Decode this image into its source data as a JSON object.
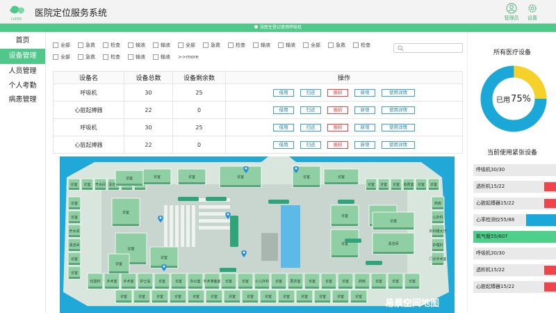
{
  "header": {
    "title": "医院定位服务系统",
    "logo_text": "LVPER",
    "actions": [
      {
        "label": "管理员",
        "icon": "user-icon"
      },
      {
        "label": "设置",
        "icon": "gear-icon"
      }
    ]
  },
  "notice": "张医生登记使用呼吸机",
  "sidebar": {
    "items": [
      {
        "label": "首页",
        "active": false
      },
      {
        "label": "设备管理",
        "active": true
      },
      {
        "label": "人员管理",
        "active": false
      },
      {
        "label": "个人考勤",
        "active": false
      },
      {
        "label": "病患管理",
        "active": false
      }
    ]
  },
  "filters": {
    "row1": [
      "全部",
      "急救",
      "检查",
      "输液",
      "输液",
      "全部",
      "急救",
      "检查",
      "输液",
      "输液",
      "全部",
      "急救",
      "检查"
    ],
    "row2": [
      "全部",
      "急救",
      "检查",
      "输液",
      "输液"
    ],
    "more": ">>more"
  },
  "table": {
    "headers": [
      "设备名",
      "设备总数",
      "设备剩余数",
      "操作"
    ],
    "op_labels": [
      "借用",
      "归还",
      "报损",
      "新增",
      "使用详情"
    ],
    "rows": [
      {
        "name": "呼吸机",
        "total": "30",
        "remain": "25",
        "remain_zero": false
      },
      {
        "name": "心脏起搏器",
        "total": "22",
        "remain": "0",
        "remain_zero": true
      },
      {
        "name": "呼吸机",
        "total": "30",
        "remain": "25",
        "remain_zero": false
      },
      {
        "name": "心脏起搏器",
        "total": "22",
        "remain": "0",
        "remain_zero": true
      }
    ]
  },
  "map": {
    "caption": "易景空间地图",
    "room_label": "诊室",
    "labels": [
      "诊室",
      "诊室",
      "开水间",
      "清洁间",
      "诊室",
      "诊室",
      "诊室",
      "诊室",
      "开水间",
      "清洁间",
      "诊室",
      "诊室",
      "诊室",
      "诊室",
      "诊室",
      "收费室",
      "诊室",
      "诊室",
      "药房",
      "心外科",
      "外科楼大厅",
      "护理科",
      "门诊手术室",
      "化验科",
      "手术室",
      "手术室",
      "护士站",
      "诊室",
      "诊室",
      "办公室",
      "手术准备室",
      "诊室",
      "诊室",
      "小儿外科",
      "诊室",
      "更衣室",
      "诊室",
      "诊室",
      "诊室",
      "药房",
      "诊室",
      "诊室",
      "诊室",
      "诊室",
      "诊室",
      "诊室",
      "诊室",
      "诊室",
      "诊室",
      "诊室",
      "诊室",
      "诊室",
      "诊室",
      "诊室",
      "诊室",
      "诊室",
      "诊室",
      "诊室",
      "诊室",
      "诊室",
      "诊室",
      "诊室",
      "诊室",
      "诊室",
      "诊室",
      "诊室",
      "诊室"
    ]
  },
  "usage": {
    "title": "所有医疗设备",
    "label": "已用",
    "percent_text": "75%",
    "percent": 0.75,
    "used_color": "#19a8d8",
    "free_color": "#f5d12a"
  },
  "shortage": {
    "title": "当前使用紧张设备",
    "items": [
      {
        "label": "呼吸机30/30",
        "fill": 1.0,
        "color": "#e9e9e9",
        "tag": ""
      },
      {
        "label": "透析机15/22",
        "fill": 0.0,
        "color": "#e9e9e9",
        "tag": "#f0444a"
      },
      {
        "label": "心脏起搏器15/22",
        "fill": 0.0,
        "color": "#e9e9e9",
        "tag": "#f0444a"
      },
      {
        "label": "心率检测仪55/88",
        "fill": 0.63,
        "color": "#e9e9e9",
        "tag": "#19a8d8"
      },
      {
        "label": "氧气瓶55/607",
        "fill": 1.0,
        "color": "#4fd08a",
        "tag": ""
      },
      {
        "label": "呼吸机30/30",
        "fill": 1.0,
        "color": "#e9e9e9",
        "tag": ""
      },
      {
        "label": "透析机15/22",
        "fill": 0.0,
        "color": "#e9e9e9",
        "tag": "#f0444a"
      },
      {
        "label": "心脏起搏器15/22",
        "fill": 0.0,
        "color": "#e9e9e9",
        "tag": "#f0444a"
      }
    ]
  },
  "colors": {
    "accent": "#4fc88a",
    "danger": "#e04646",
    "link": "#2a86b0"
  }
}
